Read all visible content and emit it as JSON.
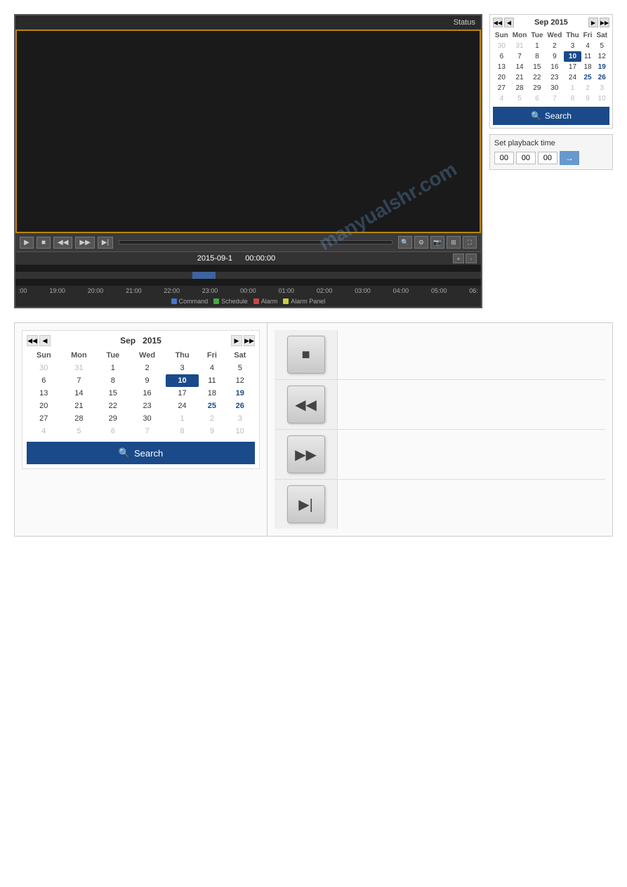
{
  "player": {
    "status_label": "Status",
    "date_display": "2015-09-1",
    "time_display": "00:00:00",
    "controls": {
      "play_label": "▶",
      "stop_label": "■",
      "rewind_label": "◀◀",
      "forward_label": "▶▶",
      "next_label": "▶|"
    },
    "timeline_labels": [
      ":00",
      "19:00",
      "20:00",
      "21:00",
      "22:00",
      "23:00",
      "00:00",
      "01:00",
      "02:00",
      "03:00",
      "04:00",
      "05:00",
      "06:"
    ],
    "legend": [
      {
        "label": "Command",
        "color": "#4477cc"
      },
      {
        "label": "Schedule",
        "color": "#44aa44"
      },
      {
        "label": "Alarm",
        "color": "#cc4444"
      },
      {
        "label": "Alarm Panel",
        "color": "#cccc44"
      }
    ]
  },
  "calendar_top": {
    "month": "Sep",
    "year": "2015",
    "days_header": [
      "Sun",
      "Mon",
      "Tue",
      "Wed",
      "Thu",
      "Fri",
      "Sat"
    ],
    "weeks": [
      [
        "30",
        "31",
        "1",
        "2",
        "3",
        "4",
        "5"
      ],
      [
        "6",
        "7",
        "8",
        "9",
        "10",
        "11",
        "12"
      ],
      [
        "13",
        "14",
        "15",
        "16",
        "17",
        "18",
        "19"
      ],
      [
        "20",
        "21",
        "22",
        "23",
        "24",
        "25",
        "26"
      ],
      [
        "27",
        "28",
        "29",
        "30",
        "1",
        "2",
        "3"
      ],
      [
        "4",
        "5",
        "6",
        "7",
        "8",
        "9",
        "10"
      ]
    ],
    "today_value": "10",
    "other_month_start": [
      "30",
      "31"
    ],
    "other_month_end": [
      "1",
      "2",
      "3",
      "4",
      "5",
      "6",
      "7",
      "8",
      "9",
      "10"
    ],
    "has_data": [
      "19",
      "25",
      "26"
    ],
    "search_label": "Search"
  },
  "playback_time": {
    "label": "Set playback time",
    "h": "00",
    "m": "00",
    "s": "00",
    "go_icon": "→"
  },
  "calendar_bottom": {
    "month": "Sep",
    "year": "2015",
    "days_header": [
      "Sun",
      "Mon",
      "Tue",
      "Wed",
      "Thu",
      "Fri",
      "Sat"
    ],
    "weeks": [
      [
        "30",
        "31",
        "1",
        "2",
        "3",
        "4",
        "5"
      ],
      [
        "6",
        "7",
        "8",
        "9",
        "10",
        "11",
        "12"
      ],
      [
        "13",
        "14",
        "15",
        "16",
        "17",
        "18",
        "19"
      ],
      [
        "20",
        "21",
        "22",
        "23",
        "24",
        "25",
        "26"
      ],
      [
        "27",
        "28",
        "29",
        "30",
        "1",
        "2",
        "3"
      ],
      [
        "4",
        "5",
        "6",
        "7",
        "8",
        "9",
        "10"
      ]
    ],
    "today_value": "10",
    "other_month_start": [
      "30",
      "31"
    ],
    "other_month_end": [
      "1",
      "2",
      "3",
      "4",
      "5",
      "6",
      "7",
      "8",
      "9",
      "10"
    ],
    "has_data": [
      "19",
      "25",
      "26"
    ],
    "search_label": "Search"
  },
  "media_buttons": [
    {
      "icon": "■",
      "name": "stop-button"
    },
    {
      "icon": "◀◀",
      "name": "rewind-button"
    },
    {
      "icon": "▶▶",
      "name": "fast-forward-button"
    },
    {
      "icon": "▶|",
      "name": "next-frame-button"
    }
  ]
}
